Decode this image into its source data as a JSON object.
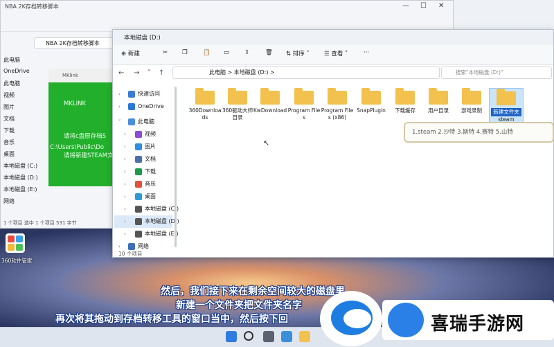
{
  "back_window": {
    "title": "NBA 2K存档转移脚本",
    "address": "NBA 2K存档转移脚本",
    "sidebar": [
      "此电脑",
      "OneDrive",
      "此电脑",
      "视频",
      "图片",
      "文档",
      "下载",
      "音乐",
      "桌面",
      "本地磁盘 (C:)",
      "本地磁盘 (D:)",
      "本地磁盘 (E:)",
      "网络"
    ],
    "status": "1 个项目   选中 1 个项目  531 字节"
  },
  "mklink_window": {
    "title": "MKlink",
    "lines": [
      "MKLINK",
      "请将c盘原存档S",
      "C:\\Users\\Public\\Do",
      "请将新建STEAM文"
    ]
  },
  "front_window": {
    "title": "本地磁盘 (D:)",
    "toolbar": {
      "new": "新建",
      "sort": "排序",
      "view": "查看",
      "more": "···"
    },
    "breadcrumb": [
      "此电脑",
      "本地磁盘 (D:)"
    ],
    "search_placeholder": "搜索\"本地磁盘 (D:)\"",
    "sidebar": [
      {
        "label": "快速访问",
        "icon": "star-icon",
        "color": "#3a7bd5"
      },
      {
        "label": "OneDrive",
        "icon": "cloud-icon",
        "color": "#2a78d6"
      },
      {
        "label": "此电脑",
        "icon": "pc-icon",
        "color": "#4a90d9"
      },
      {
        "label": "视频",
        "icon": "video-icon",
        "color": "#8a4bd6"
      },
      {
        "label": "图片",
        "icon": "picture-icon",
        "color": "#2e8fe0"
      },
      {
        "label": "文档",
        "icon": "document-icon",
        "color": "#4d6fa8"
      },
      {
        "label": "下载",
        "icon": "download-icon",
        "color": "#1c9a4b"
      },
      {
        "label": "音乐",
        "icon": "music-icon",
        "color": "#e0533a"
      },
      {
        "label": "桌面",
        "icon": "desktop-icon",
        "color": "#2a9bd8"
      },
      {
        "label": "本地磁盘 (C:)",
        "icon": "drive-icon",
        "color": "#555555"
      },
      {
        "label": "本地磁盘 (D:)",
        "icon": "drive-icon",
        "color": "#555555"
      },
      {
        "label": "本地磁盘 (E:)",
        "icon": "drive-icon",
        "color": "#555555"
      },
      {
        "label": "网络",
        "icon": "network-icon",
        "color": "#3b6fb6"
      }
    ],
    "folders": [
      "360Downloads",
      "360驱动大师目录",
      "KwDownload",
      "Program Files",
      "Program Files (x86)",
      "SnapPlugin",
      "下载缓存",
      "用户目录",
      "游戏录制",
      "新建文件夹"
    ],
    "rename_value": "steam",
    "status": "10 个项目"
  },
  "hint": "1.steam  2.沙特  3.斯特  4.赛特  5.山特",
  "desktop": {
    "app_label": "360软件管家"
  },
  "subtitles": [
    "然后，我们接下来在剩余空间较大的磁盘里",
    "新建一个文件夹把文件夹名字",
    "再次将其拖动到存档转移工具的窗口当中，然后按下回"
  ],
  "watermark": "喜瑞手游网"
}
